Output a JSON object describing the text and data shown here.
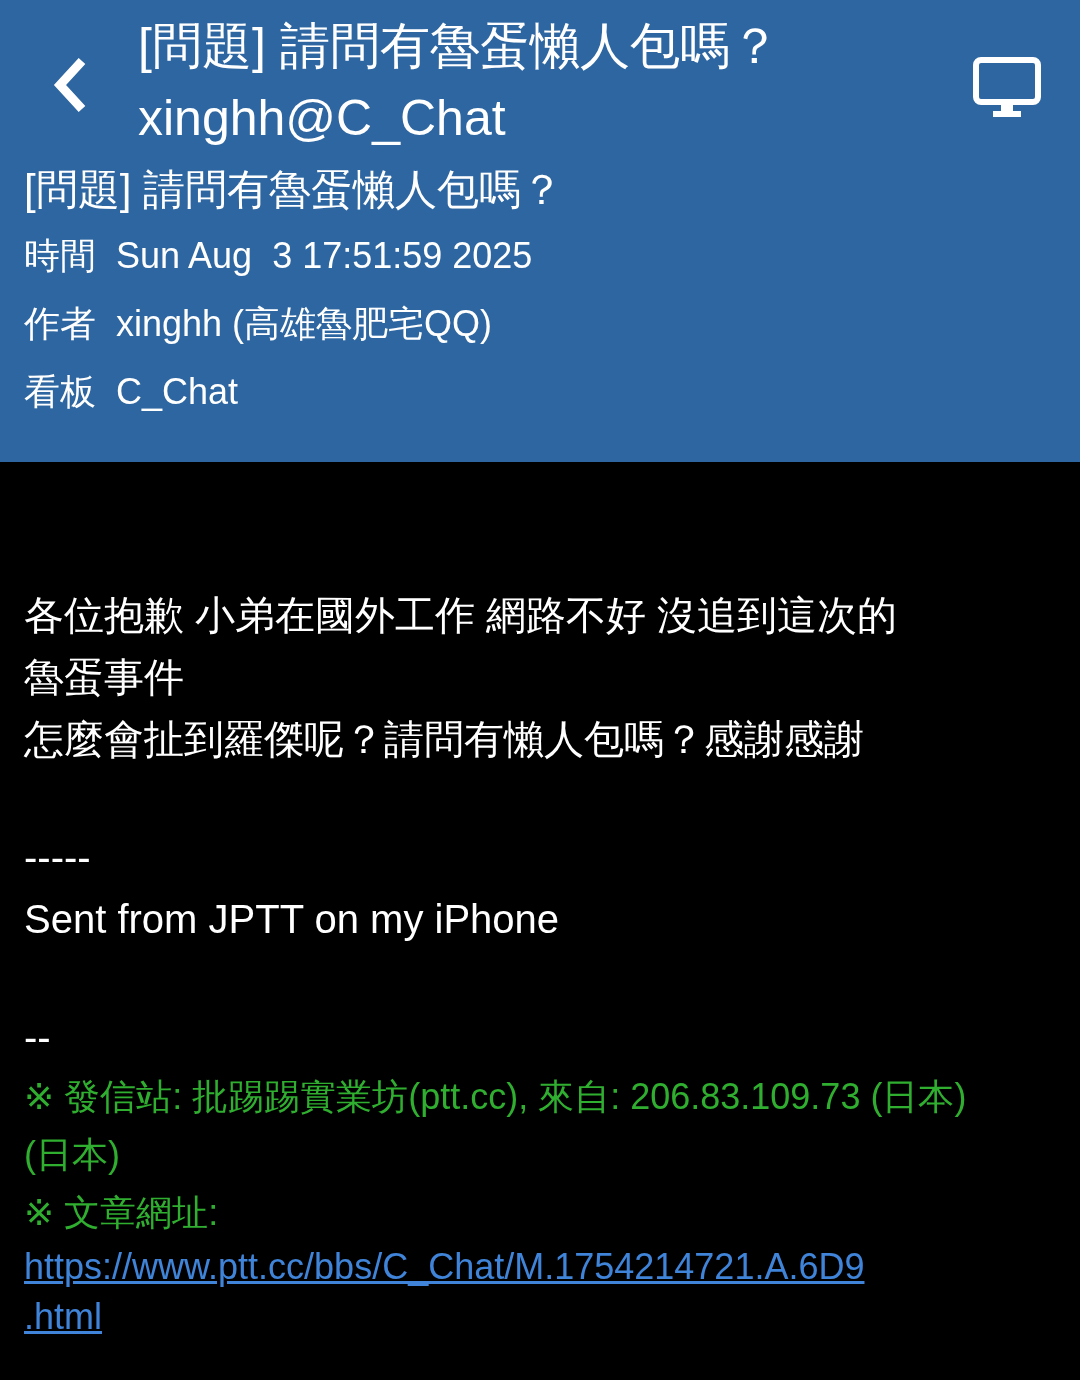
{
  "header": {
    "title": "[問題] 請問有魯蛋懶人包嗎？",
    "subtitle": "xinghh@C_Chat"
  },
  "article": {
    "title": "[問題] 請問有魯蛋懶人包嗎？",
    "meta": [
      {
        "label": "時間",
        "value": "Sun Aug  3 17:51:59 2025"
      },
      {
        "label": "作者",
        "value": "xinghh (高雄魯肥宅QQ)"
      },
      {
        "label": "看板",
        "value": "C_Chat"
      }
    ]
  },
  "body": [
    {
      "kind": "blank"
    },
    {
      "kind": "blank"
    },
    {
      "kind": "text",
      "text": "各位抱歉 小弟在國外工作 網路不好 沒追到這次的"
    },
    {
      "kind": "text",
      "text": "魯蛋事件"
    },
    {
      "kind": "text",
      "text": "怎麼會扯到羅傑呢？請問有懶人包嗎？感謝感謝"
    },
    {
      "kind": "blank"
    },
    {
      "kind": "text",
      "text": "-----"
    },
    {
      "kind": "text",
      "text": "Sent from JPTT on my iPhone"
    },
    {
      "kind": "blank"
    },
    {
      "kind": "text",
      "text": "--"
    },
    {
      "kind": "signature",
      "text": "※ 發信站: 批踢踢實業坊(ptt.cc), 來自: 206.83.109.73 (日本)"
    },
    {
      "kind": "signature",
      "text": "(日本)"
    },
    {
      "kind": "signature",
      "text": "※ 文章網址:"
    },
    {
      "kind": "link",
      "text": "https://www.ptt.cc/bbs/C_Chat/M.1754214721.A.6D9"
    },
    {
      "kind": "link",
      "text": ".html"
    }
  ]
}
